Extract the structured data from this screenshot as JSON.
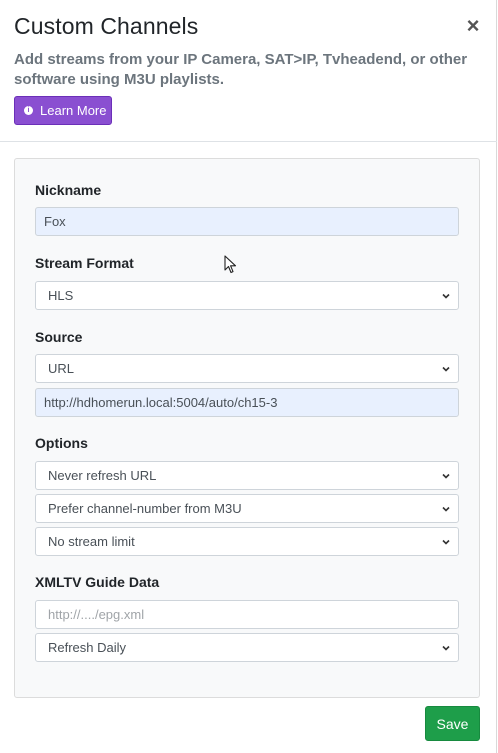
{
  "modal": {
    "title": "Custom Channels",
    "close_glyph": "×",
    "subtitle": "Add streams from your IP Camera, SAT>IP, Tvheadend, or other software using M3U playlists.",
    "learn_more_label": "Learn More",
    "learn_more_icon": "info-icon"
  },
  "form": {
    "nickname_label": "Nickname",
    "nickname_value": "Fox",
    "stream_format_label": "Stream Format",
    "stream_format_value": "HLS",
    "source_label": "Source",
    "source_type_value": "URL",
    "source_url_value": "http://hdhomerun.local:5004/auto/ch15-3",
    "options_label": "Options",
    "refresh_option_value": "Never refresh URL",
    "channel_number_option_value": "Prefer channel-number from M3U",
    "stream_limit_option_value": "No stream limit",
    "xmltv_label": "XMLTV Guide Data",
    "xmltv_placeholder": "http://..../epg.xml",
    "xmltv_refresh_value": "Refresh Daily"
  },
  "footer": {
    "save_label": "Save"
  },
  "colors": {
    "accent_purple": "#8a4fd1",
    "save_green": "#1e9e4a",
    "filled_input_bg": "#e8f0fe"
  }
}
